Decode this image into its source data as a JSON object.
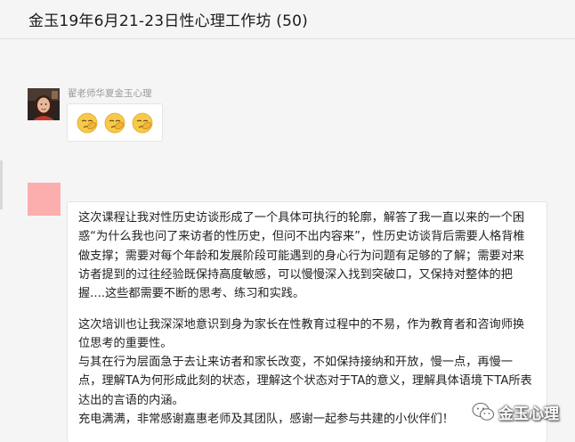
{
  "header": {
    "title": "金玉19年6月21-23日性心理工作坊 (50)"
  },
  "messages": [
    {
      "sender": "翟老师华夏金玉心理",
      "avatar": "avatar-photo-woman",
      "emojis": [
        "facepalm-emoji",
        "facepalm-emoji",
        "facepalm-emoji"
      ]
    },
    {
      "avatar": "avatar-pink",
      "paragraphs": [
        "这次课程让我对性历史访谈形成了一个具体可执行的轮廓，解答了我一直以来的一个困惑“为什么我也问了来访者的性历史，但问不出内容来”，性历史访谈背后需要人格背椎做支撑；需要对每个年龄和发展阶段可能遇到的身心行为问题有足够的了解；需要对来访者提到的过往经验既保持高度敏感，可以慢慢深入找到突破口，又保持对整体的把握....这些都需要不断的思考、练习和实践。",
        "这次培训也让我深深地意识到身为家长在性教育过程中的不易，作为教育者和咨询师换位思考的重要性。",
        "与其在行为层面急于去让来访者和家长改变，不如保持接纳和开放，慢一点，再慢一点，理解TA为何形成此刻的状态，理解这个状态对于TA的意义，理解具体语境下TA所表达出的言语的内涵。",
        "充电满满，非常感谢嘉惠老师及其团队，感谢一起参与共建的小伙伴们！"
      ]
    }
  ],
  "watermark": {
    "text": "金玉心理",
    "icon": "wechat-logo-icon"
  },
  "colors": {
    "background": "#f5f5f5",
    "bubble": "#ffffff",
    "sender_name": "#9a9a9a",
    "pink_avatar": "#fcaeae"
  }
}
